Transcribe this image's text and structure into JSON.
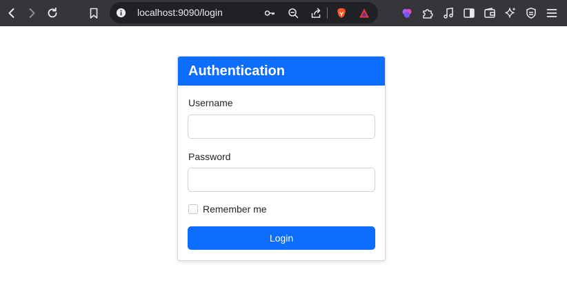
{
  "browser": {
    "url": "localhost:9090/login",
    "icons": {
      "back": "arrow-left-icon",
      "forward": "arrow-right-icon",
      "reload": "reload-icon",
      "bookmark": "bookmark-icon",
      "site_info": "info-icon",
      "password_key": "key-icon",
      "zoom": "zoom-out-icon",
      "share": "share-icon",
      "brave_shields": "brave-lion-icon",
      "brave_rewards": "triangle-icon",
      "leo": "brain-icon",
      "extensions": "puzzle-icon",
      "media": "music-note-icon",
      "sidebar": "sidebar-icon",
      "wallet": "wallet-icon",
      "sparkle": "sparkle-icon",
      "vpn": "shield-icon",
      "menu": "hamburger-menu-icon"
    }
  },
  "login": {
    "title": "Authentication",
    "username_label": "Username",
    "username_value": "",
    "password_label": "Password",
    "password_value": "",
    "remember_label": "Remember me",
    "submit_label": "Login"
  },
  "colors": {
    "toolbar": "#35363a",
    "omnibox": "#202124",
    "primary": "#0d6efd"
  }
}
